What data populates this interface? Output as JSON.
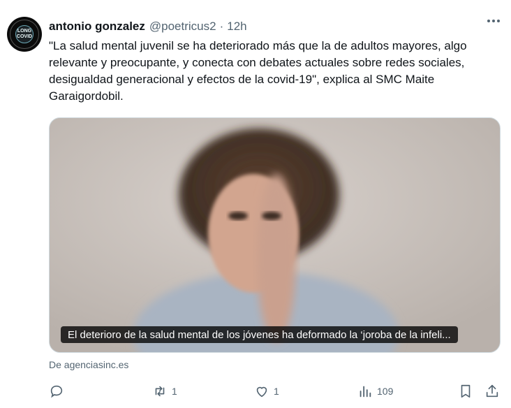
{
  "tweet": {
    "author_name": "antonio gonzalez",
    "handle": "@poetricus2",
    "separator": "·",
    "time": "12h",
    "text": "\"La salud mental juvenil se ha deteriorado más que la de adultos mayores, algo relevante y preocupante, y conecta con debates actuales sobre redes sociales, desigualdad generacional y efectos de la covid-19\", explica al SMC Maite Garaigordobil.",
    "avatar_text_top": "LONG",
    "avatar_text_bottom": "COVID"
  },
  "card": {
    "caption": "El deterioro de la salud mental de los jóvenes ha deformado la ‘joroba de la infeli...",
    "source": "De agenciasinc.es"
  },
  "actions": {
    "reply_count": "",
    "retweet_count": "1",
    "like_count": "1",
    "views_count": "109"
  },
  "colors": {
    "text": "#0f1419",
    "muted": "#536471",
    "border": "#cfd9de"
  }
}
